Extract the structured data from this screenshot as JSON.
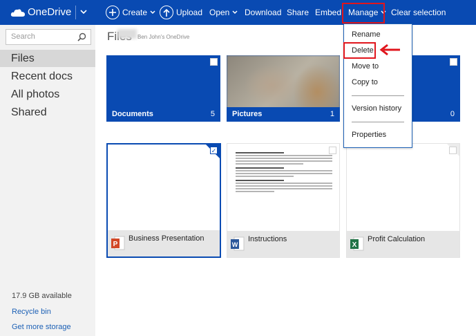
{
  "brand": {
    "name": "OneDrive"
  },
  "commands": {
    "create": "Create",
    "upload": "Upload",
    "open": "Open",
    "download": "Download",
    "share": "Share",
    "embed": "Embed",
    "manage": "Manage",
    "clear_selection": "Clear selection"
  },
  "search": {
    "placeholder": "Search"
  },
  "sidebar": {
    "items": [
      {
        "label": "Files",
        "selected": true
      },
      {
        "label": "Recent docs"
      },
      {
        "label": "All photos"
      },
      {
        "label": "Shared"
      }
    ],
    "storage": "17.9 GB available",
    "recycle_bin": "Recycle bin",
    "get_storage": "Get more storage"
  },
  "breadcrumb": {
    "title": "Files",
    "owner": "Ben John's OneDrive"
  },
  "folders": [
    {
      "name": "Documents",
      "count": "5"
    },
    {
      "name": "Pictures",
      "count": "1"
    },
    {
      "name": "",
      "count": "0"
    }
  ],
  "files": [
    {
      "name": "Business Presentation",
      "type": "powerpoint",
      "selected": true
    },
    {
      "name": "Instructions",
      "type": "word"
    },
    {
      "name": "Profit Calculation",
      "type": "excel"
    }
  ],
  "manage_menu": {
    "items": [
      "Rename",
      "Delete",
      "Move to",
      "Copy to",
      "Version history",
      "Properties"
    ]
  },
  "colors": {
    "accent": "#094AB2",
    "highlight": "#E0151C",
    "sidebar": "#F2F2F2"
  }
}
